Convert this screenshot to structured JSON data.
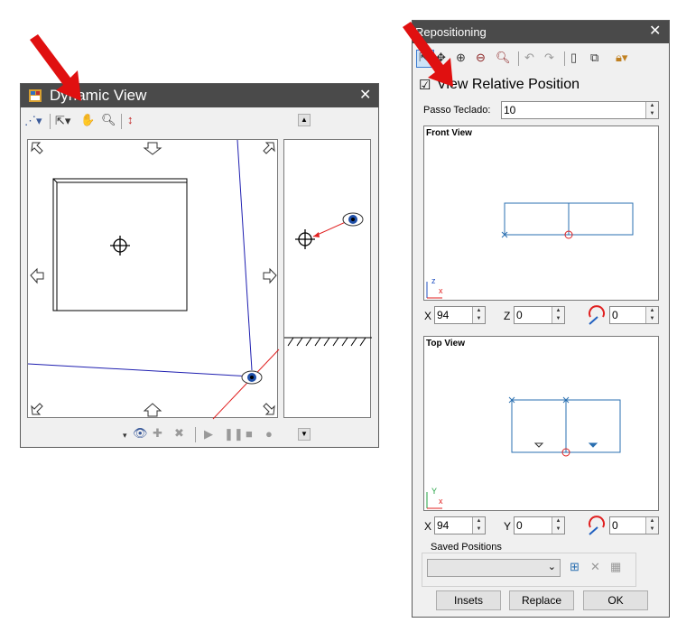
{
  "dynamic_view": {
    "title": "Dynamic View",
    "close": "✕"
  },
  "repositioning": {
    "title": "Repositioning",
    "close": "✕",
    "view_relative_checkbox": {
      "label": "View Relative Position",
      "checked": true,
      "mark": "☑"
    },
    "passo_teclado": {
      "label": "Passo Teclado:",
      "value": "10"
    },
    "front_view": {
      "title": "Front View",
      "axis_z": "z",
      "axis_x": "x",
      "x_label": "X",
      "x_value": "94",
      "z_label": "Z",
      "z_value": "0",
      "rot_value": "0"
    },
    "top_view": {
      "title": "Top View",
      "axis_y": "Y",
      "axis_x": "x",
      "x_label": "X",
      "x_value": "94",
      "y_label": "Y",
      "y_value": "0",
      "rot_value": "0"
    },
    "saved_positions": {
      "label": "Saved Positions",
      "selected": ""
    },
    "buttons": {
      "insets": "Insets",
      "replace": "Replace",
      "ok": "OK"
    }
  },
  "colors": {
    "titlebar": "#4a4a4a",
    "accent_red": "#e02020",
    "view_line_blue": "#1f1fb0",
    "drawing_blue": "#2a6fb0"
  },
  "icons": [
    "red-arrow-annotation",
    "eye-icon",
    "crosshair-icon",
    "pan-hand-icon",
    "zoom-icon",
    "undo-icon",
    "redo-icon",
    "lock-icon",
    "record-icon",
    "play-icon",
    "pause-icon",
    "stop-icon"
  ]
}
